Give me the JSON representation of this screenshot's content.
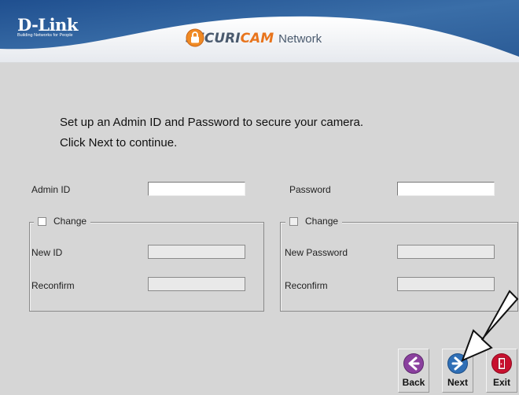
{
  "header": {
    "brand_name": "D-Link",
    "brand_tagline": "Building Networks for People",
    "product_part1": "SECURI",
    "product_part2": "CAM",
    "product_part3": "Network"
  },
  "instructions": {
    "line1": "Set up an Admin ID and Password to secure your camera.",
    "line2": "Click Next to continue."
  },
  "form": {
    "admin_id_label": "Admin ID",
    "admin_id_value": "",
    "password_label": "Password",
    "password_value": "",
    "left_group": {
      "change_label": "Change",
      "checked": false,
      "new_id_label": "New ID",
      "new_id_value": "",
      "reconfirm_label": "Reconfirm",
      "reconfirm_value": ""
    },
    "right_group": {
      "change_label": "Change",
      "checked": false,
      "new_password_label": "New Password",
      "new_password_value": "",
      "reconfirm_label": "Reconfirm",
      "reconfirm_value": ""
    }
  },
  "nav": {
    "back_label": "Back",
    "next_label": "Next",
    "exit_label": "Exit"
  },
  "colors": {
    "banner_blue": "#2f5d9b",
    "accent_orange": "#e8741c",
    "back_purple": "#8a3f9e",
    "next_blue": "#2f6fb6",
    "exit_red": "#c8102e"
  },
  "icons": {
    "lock": "lock-icon",
    "back": "back-arrow-icon",
    "next": "next-arrow-icon",
    "exit": "exit-door-icon",
    "pointer": "pointer-arrow-icon"
  }
}
